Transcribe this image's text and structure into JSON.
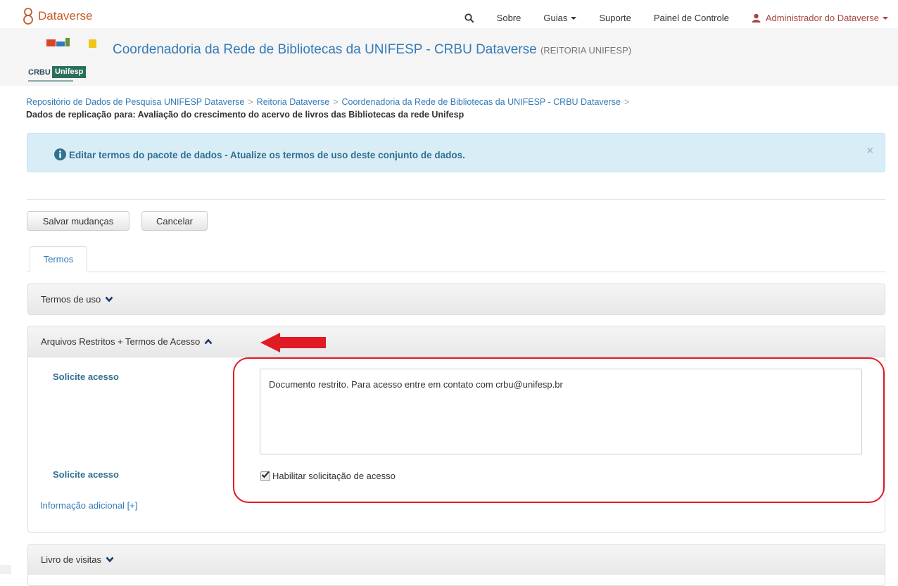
{
  "navbar": {
    "brand": "Dataverse",
    "items": [
      "Sobre",
      "Guias",
      "Suporte",
      "Painel de Controle"
    ],
    "user": "Administrador do Dataverse"
  },
  "dataverse": {
    "title": "Coordenadoria da Rede de Bibliotecas da UNIFESP - CRBU Dataverse",
    "affiliation": "(REITORIA UNIFESP)",
    "logo_text_left": "CRBU",
    "logo_text_right": "Unifesp"
  },
  "breadcrumb": {
    "links": [
      "Repositório de Dados de Pesquisa UNIFESP Dataverse",
      "Reitoria Dataverse",
      "Coordenadoria da Rede de Bibliotecas da UNIFESP - CRBU Dataverse"
    ],
    "separator": ">",
    "current": "Dados de replicação para: Avaliação do crescimento do acervo de livros das Bibliotecas da rede Unifesp"
  },
  "alert": {
    "text": "Editar termos do pacote de dados - Atualize os termos de uso deste conjunto de dados.",
    "close": "×"
  },
  "actions": {
    "save": "Salvar mudanças",
    "cancel": "Cancelar"
  },
  "tabs": [
    "Termos"
  ],
  "panels": {
    "terms_of_use": "Termos de uso",
    "restricted": "Arquivos Restritos + Termos de Acesso",
    "guestbook": "Livro de visitas"
  },
  "restricted_section": {
    "request_label_1": "Solicite acesso",
    "request_text": "Documento restrito. Para acesso entre em contato com crbu@unifesp.br",
    "request_label_2": "Solicite acesso",
    "enable_request_label": "Habilitar solicitação de acesso",
    "enable_request_checked": true,
    "additional_info": "Informação adicional [+]"
  },
  "colors": {
    "brand": "#c55b28",
    "link": "#337ab7",
    "alert_bg": "#d9edf7",
    "annotation_red": "#e01b24"
  }
}
